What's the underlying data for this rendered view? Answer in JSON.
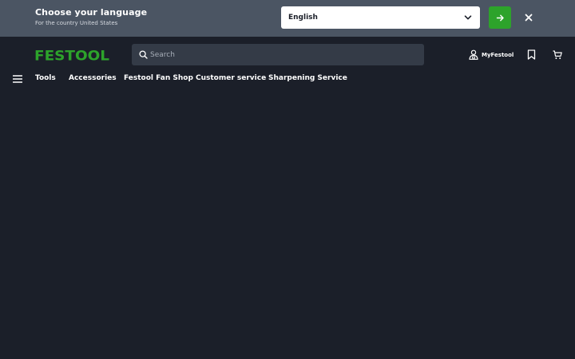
{
  "language_banner": {
    "title": "Choose your language",
    "subtitle": "For the country United States",
    "selected_language": "English",
    "select_icon": "chevron-down-icon",
    "submit_icon": "arrow-right-icon",
    "close_icon": "close-icon"
  },
  "header": {
    "logo_text": "FESTOOL",
    "search": {
      "placeholder": "Search",
      "value": "",
      "icon": "search-icon"
    },
    "account_label": "MyFestool",
    "account_icon": "user-icon",
    "bookmark_icon": "bookmark-icon",
    "cart_icon": "cart-icon"
  },
  "nav": {
    "menu_icon": "hamburger-menu-icon",
    "items": [
      {
        "label": "Tools"
      },
      {
        "label": "Accessories"
      },
      {
        "label": "Festool Fan Shop"
      },
      {
        "label": "Customer service"
      },
      {
        "label": "Sharpening Service"
      }
    ]
  },
  "colors": {
    "page_background": "#1b1f29",
    "banner_background": "#4b5563",
    "search_background": "#343b47",
    "brand_green": "#2da32b",
    "text": "#ffffff"
  }
}
